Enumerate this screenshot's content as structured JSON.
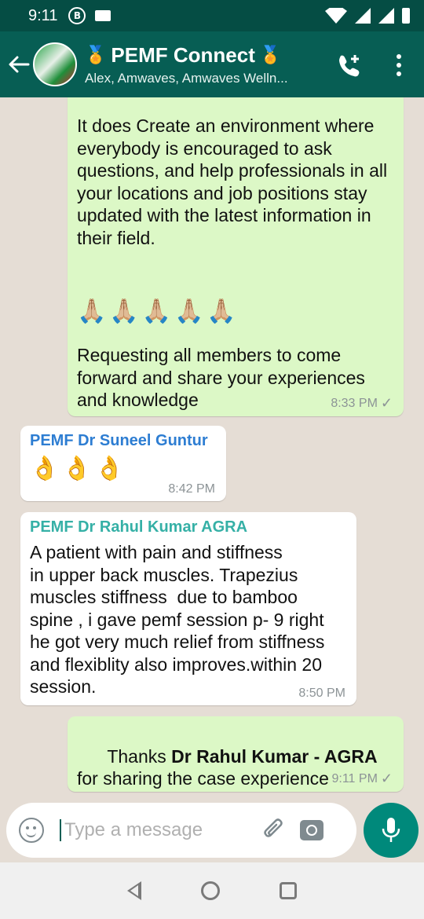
{
  "status_bar": {
    "time": "9:11",
    "badge": "B"
  },
  "header": {
    "title": "PEMF Connect",
    "subtitle": "Alex, Amwaves, Amwaves Welln...",
    "medal": "🏅"
  },
  "messages": [
    {
      "direction": "out",
      "text": "It does Create an environment where everybody is encouraged to ask questions, and help professionals in all your locations and job positions stay updated with the latest information in their field.",
      "emoji_line": "🙏🏼🙏🏼🙏🏼🙏🏼🙏🏼",
      "text2": "Requesting all members to come forward and share your experiences and knowledge",
      "time": "8:33 PM"
    },
    {
      "direction": "in",
      "sender": "PEMF Dr Suneel Guntur",
      "sender_color": "#2d7dd2",
      "emoji_line": "👌👌👌",
      "time": "8:42 PM"
    },
    {
      "direction": "in",
      "sender": "PEMF Dr Rahul Kumar AGRA",
      "sender_color": "#35b0a6",
      "text": "A patient with pain and stiffness\nin upper back muscles. Trapezius\nmuscles stiffness  due to bamboo\nspine , i gave pemf session p- 9 right\nhe got very much relief from stiffness\nand flexiblity also improves.within 20\nsession.",
      "time": "8:50 PM"
    },
    {
      "direction": "out",
      "text_prefix": "Thanks ",
      "text_bold": "Dr Rahul Kumar - AGRA",
      "text_suffix": " for sharing the case experience",
      "time": "9:11 PM"
    }
  ],
  "input": {
    "placeholder": "Type a message"
  },
  "icons": {
    "back": "back-arrow-icon",
    "call": "add-call-icon",
    "menu": "more-vert-icon",
    "emoji": "smiley-icon",
    "attach": "paperclip-icon",
    "camera": "camera-icon",
    "mic": "mic-icon",
    "tick": "✓"
  },
  "colors": {
    "header": "#075e54",
    "status_bar": "#054d44",
    "outgoing_bubble": "#dcf8c6",
    "incoming_bubble": "#ffffff",
    "fab": "#00897b"
  }
}
